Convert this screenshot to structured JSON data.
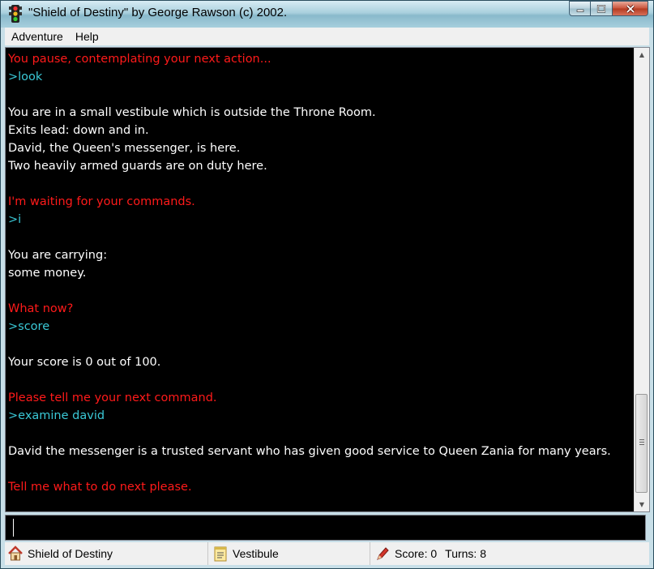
{
  "window": {
    "title": "\"Shield of Destiny\" by George Rawson (c) 2002."
  },
  "menu": {
    "items": [
      "Adventure",
      "Help"
    ]
  },
  "transcript": [
    {
      "text": "You pause, contemplating your next action...",
      "color": "red"
    },
    {
      "text": ">look",
      "color": "cyan"
    },
    {
      "text": "",
      "color": "white"
    },
    {
      "text": "You are in a small vestibule which is outside the Throne Room.",
      "color": "white"
    },
    {
      "text": "Exits lead: down and in.",
      "color": "white"
    },
    {
      "text": "David, the Queen's messenger, is here.",
      "color": "white"
    },
    {
      "text": "Two heavily armed guards are on duty here.",
      "color": "white"
    },
    {
      "text": "",
      "color": "white"
    },
    {
      "text": "I'm waiting for your commands.",
      "color": "red"
    },
    {
      "text": ">i",
      "color": "cyan"
    },
    {
      "text": "",
      "color": "white"
    },
    {
      "text": "You are carrying:",
      "color": "white"
    },
    {
      "text": "some money.",
      "color": "white"
    },
    {
      "text": "",
      "color": "white"
    },
    {
      "text": "What now?",
      "color": "red"
    },
    {
      "text": ">score",
      "color": "cyan"
    },
    {
      "text": "",
      "color": "white"
    },
    {
      "text": "Your score is 0 out of 100.",
      "color": "white"
    },
    {
      "text": "",
      "color": "white"
    },
    {
      "text": "Please tell me your next command.",
      "color": "red"
    },
    {
      "text": ">examine david",
      "color": "cyan"
    },
    {
      "text": "",
      "color": "white"
    },
    {
      "text": "David the messenger is a trusted servant who has given good service to Queen Zania for many years.",
      "color": "white"
    },
    {
      "text": "",
      "color": "white"
    },
    {
      "text": "Tell me what to do next please.",
      "color": "red"
    }
  ],
  "command_input": {
    "value": ""
  },
  "statusbar": {
    "game_name": "Shield of Destiny",
    "location": "Vestibule",
    "score_label": "Score:",
    "score_value": "0",
    "turns_label": "Turns:",
    "turns_value": "8",
    "icons": {
      "game": "home-icon",
      "location": "notepad-icon",
      "score": "pencil-icon"
    }
  },
  "colors": {
    "red": "#ff1a1a",
    "cyan": "#3ac8d6",
    "white": "#ffffff",
    "background": "#000000"
  }
}
